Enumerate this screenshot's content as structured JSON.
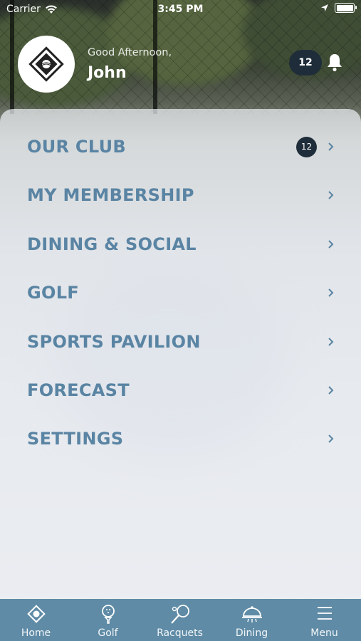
{
  "status_bar": {
    "carrier": "Carrier",
    "time": "3:45 PM"
  },
  "header": {
    "greeting": "Good Afternoon,",
    "user_name": "John",
    "notification_count": "12"
  },
  "menu": {
    "items": [
      {
        "label": "OUR CLUB",
        "badge": "12"
      },
      {
        "label": "MY MEMBERSHIP"
      },
      {
        "label": "DINING & SOCIAL"
      },
      {
        "label": "GOLF"
      },
      {
        "label": "SPORTS PAVILION"
      },
      {
        "label": "FORECAST"
      },
      {
        "label": "SETTINGS"
      }
    ]
  },
  "tabbar": {
    "tabs": [
      {
        "label": "Home",
        "icon": "home-diamond-icon"
      },
      {
        "label": "Golf",
        "icon": "golf-ball-tee-icon"
      },
      {
        "label": "Racquets",
        "icon": "racquet-icon"
      },
      {
        "label": "Dining",
        "icon": "cloche-icon"
      },
      {
        "label": "Menu",
        "icon": "hamburger-menu-icon"
      }
    ]
  },
  "colors": {
    "menu_text": "#5a84a3",
    "badge_bg": "#1f2d3a",
    "tabbar_bg": "#5f8ba6"
  }
}
